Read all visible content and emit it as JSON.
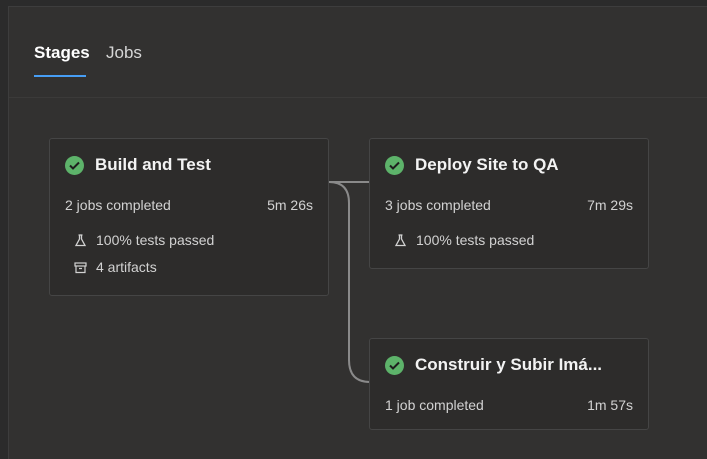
{
  "tabs": [
    {
      "label": "Stages",
      "active": true
    },
    {
      "label": "Jobs",
      "active": false
    }
  ],
  "colors": {
    "accent": "#479ef5",
    "success": "#5db36a",
    "background": "#323130",
    "card": "#2d2c2b"
  },
  "stages": [
    {
      "title": "Build and Test",
      "status_icon": "check-circle-icon",
      "jobs_text": "2 jobs completed",
      "duration": "5m 26s",
      "tests": "100% tests passed",
      "artifacts": "4 artifacts"
    },
    {
      "title": "Deploy Site to QA",
      "status_icon": "check-circle-icon",
      "jobs_text": "3 jobs completed",
      "duration": "7m 29s",
      "tests": "100% tests passed"
    },
    {
      "title": "Construir y Subir Imá...",
      "status_icon": "check-circle-icon",
      "jobs_text": "1 job completed",
      "duration": "1m 57s"
    }
  ]
}
